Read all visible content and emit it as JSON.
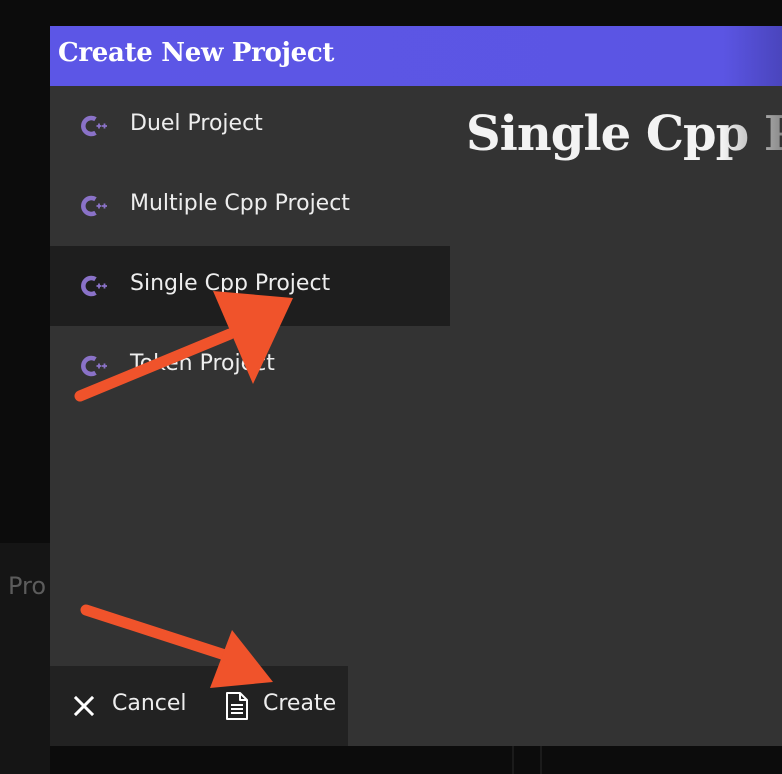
{
  "dialog": {
    "title": "Create New Project",
    "title_bar_color": "#5c56e6",
    "background_color": "#333333"
  },
  "project_types": [
    {
      "label": "Duel Project",
      "icon": "cpp-icon",
      "selected": false
    },
    {
      "label": "Multiple Cpp Project",
      "icon": "cpp-icon",
      "selected": false
    },
    {
      "label": "Single Cpp Project",
      "icon": "cpp-icon",
      "selected": true
    },
    {
      "label": "Token Project",
      "icon": "cpp-icon",
      "selected": false
    }
  ],
  "detail": {
    "heading": "Single Cpp Pr"
  },
  "footer": {
    "cancel_label": "Cancel",
    "cancel_icon": "close-icon",
    "create_label": "Create",
    "create_icon": "document-icon"
  },
  "background": {
    "partial_label": "Pro"
  },
  "annotations": {
    "arrow_color": "#f0532b",
    "arrows": [
      "arrow pointing to Single Cpp Project",
      "arrow pointing to Create button"
    ]
  }
}
